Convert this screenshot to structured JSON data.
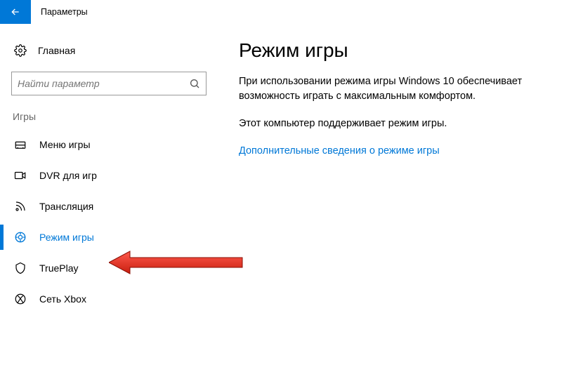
{
  "window": {
    "title": "Параметры"
  },
  "sidebar": {
    "home_label": "Главная",
    "search_placeholder": "Найти параметр",
    "category": "Игры",
    "items": [
      {
        "label": "Меню игры"
      },
      {
        "label": "DVR для игр"
      },
      {
        "label": "Трансляция"
      },
      {
        "label": "Режим игры"
      },
      {
        "label": "TruePlay"
      },
      {
        "label": "Сеть Xbox"
      }
    ]
  },
  "main": {
    "heading": "Режим игры",
    "p1": "При использовании режима игры Windows 10 обеспечивает возможность играть с максимальным комфортом.",
    "p2": "Этот компьютер поддерживает режим игры.",
    "link": "Дополнительные сведения о режиме игры"
  }
}
